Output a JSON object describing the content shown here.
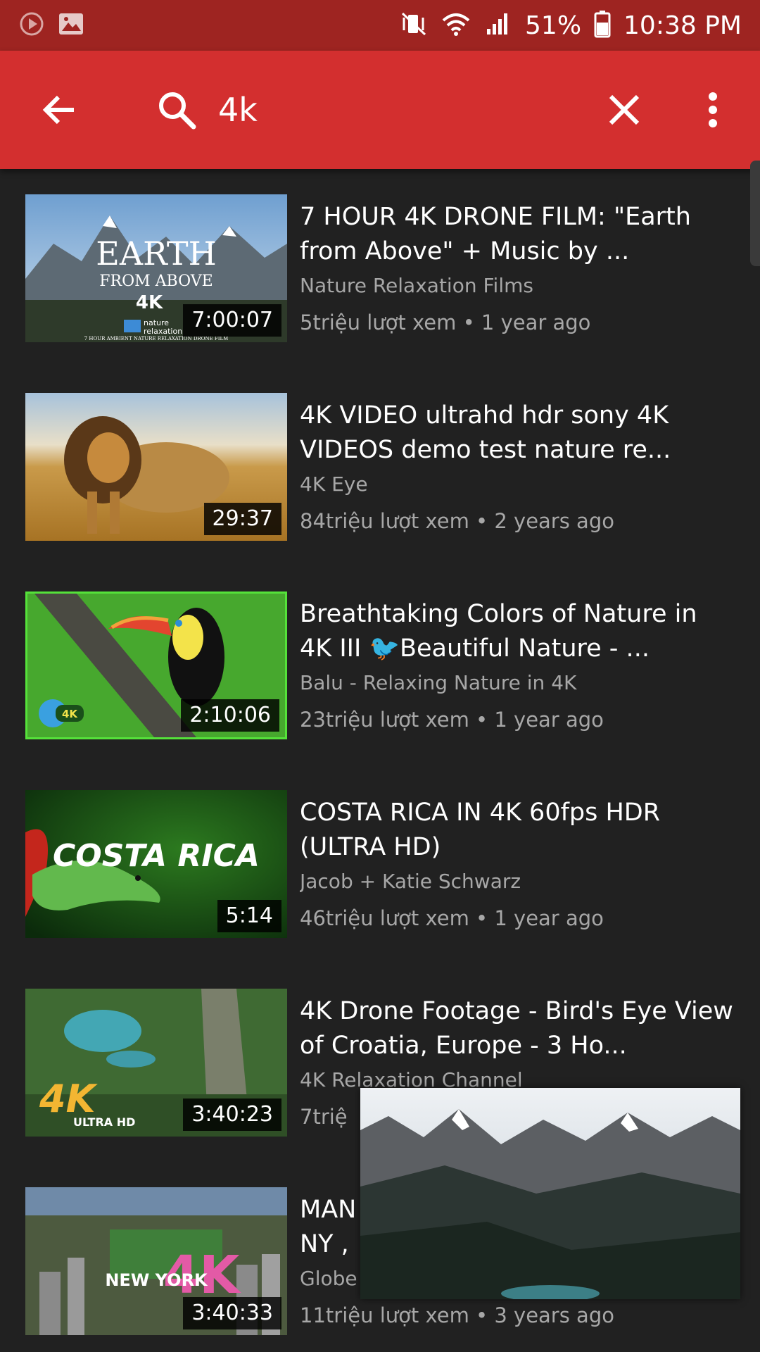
{
  "status_bar": {
    "battery": "51%",
    "time": "10:38 PM",
    "left_icons": [
      "play-circle-icon",
      "image-icon"
    ],
    "right_icons": [
      "vibrate-icon",
      "wifi-icon",
      "signal-icon",
      "battery-icon"
    ]
  },
  "toolbar": {
    "back_icon": "arrow-left-icon",
    "search_icon": "search-icon",
    "query": "4k",
    "clear_icon": "close-icon",
    "menu_icon": "more-vert-icon",
    "background": "#d32f2f"
  },
  "results": [
    {
      "title": "7 HOUR 4K DRONE FILM: \"Earth from Above\" + Music by ...",
      "channel": "Nature Relaxation Films",
      "stats": "5triệu lượt xem • 1 year ago",
      "duration": "7:00:07",
      "thumb_text": [
        "EARTH",
        "FROM ABOVE",
        "4K",
        "nature",
        "relaxation",
        "7 HOUR AMBIENT NATURE RELAXATION DRONE FILM"
      ]
    },
    {
      "title": "4K VIDEO ultrahd hdr sony 4K VIDEOS demo test nature re...",
      "channel": "4K Eye",
      "stats": "84triệu lượt xem • 2 years ago",
      "duration": "29:37"
    },
    {
      "title": "Breathtaking Colors of Nature in 4K III 🐦Beautiful Nature - ...",
      "channel": "Balu - Relaxing Nature in 4K",
      "stats": "23triệu lượt xem • 1 year ago",
      "duration": "2:10:06",
      "thumb_text": [
        "4K"
      ]
    },
    {
      "title": "COSTA RICA IN 4K 60fps HDR (ULTRA HD)",
      "channel": "Jacob + Katie Schwarz",
      "stats": "46triệu lượt xem • 1 year ago",
      "duration": "5:14",
      "thumb_text": [
        "COSTA RICA"
      ]
    },
    {
      "title": "4K Drone Footage - Bird's Eye View of Croatia, Europe - 3 Ho...",
      "channel": "4K Relaxation Channel",
      "stats": "7triệ",
      "duration": "3:40:23",
      "thumb_text": [
        "4K",
        "ULTRA HD"
      ]
    },
    {
      "title": "MAN​\nNY ,",
      "channel": "Globe",
      "stats": "11triệu lượt xem • 3 years ago",
      "duration": "3:40:33",
      "thumb_text": [
        "4K",
        "NEW YORK"
      ]
    }
  ],
  "mini_player": {
    "description_icon": "video-preview-mountains"
  }
}
